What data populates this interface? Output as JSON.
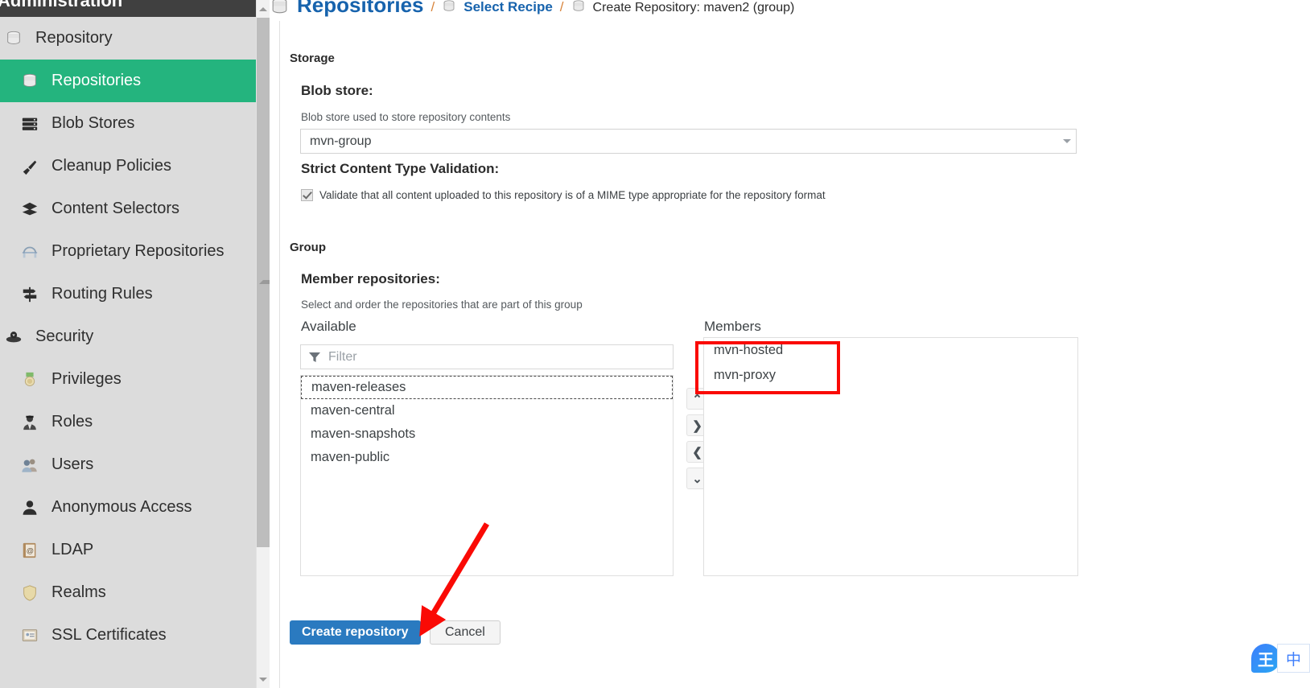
{
  "app": {
    "header_title": "Administration"
  },
  "sidebar": {
    "items": [
      {
        "label": "Repository",
        "icon": "database-icon",
        "level": 0,
        "active": false
      },
      {
        "label": "Repositories",
        "icon": "database-icon",
        "level": 1,
        "active": true
      },
      {
        "label": "Blob Stores",
        "icon": "server-icon",
        "level": 1,
        "active": false
      },
      {
        "label": "Cleanup Policies",
        "icon": "broom-icon",
        "level": 1,
        "active": false
      },
      {
        "label": "Content Selectors",
        "icon": "layers-icon",
        "level": 1,
        "active": false
      },
      {
        "label": "Proprietary Repositories",
        "icon": "bridge-icon",
        "level": 1,
        "active": false
      },
      {
        "label": "Routing Rules",
        "icon": "signpost-icon",
        "level": 1,
        "active": false
      },
      {
        "label": "Security",
        "icon": "shield-user-icon",
        "level": 0,
        "active": false
      },
      {
        "label": "Privileges",
        "icon": "medal-icon",
        "level": 1,
        "active": false
      },
      {
        "label": "Roles",
        "icon": "officer-icon",
        "level": 1,
        "active": false
      },
      {
        "label": "Users",
        "icon": "users-icon",
        "level": 1,
        "active": false
      },
      {
        "label": "Anonymous Access",
        "icon": "person-icon",
        "level": 1,
        "active": false
      },
      {
        "label": "LDAP",
        "icon": "address-book-icon",
        "level": 1,
        "active": false
      },
      {
        "label": "Realms",
        "icon": "shield-icon",
        "level": 1,
        "active": false
      },
      {
        "label": "SSL Certificates",
        "icon": "certificate-icon",
        "level": 1,
        "active": false
      }
    ],
    "active_color": "#24b47e",
    "background": "#dcdcdc"
  },
  "breadcrumb": {
    "separator": "/",
    "items": [
      {
        "label": "Repositories",
        "icon": "database-icon",
        "link": true
      },
      {
        "label": "Select Recipe",
        "icon": "database-icon",
        "link": true
      },
      {
        "label": "Create Repository: maven2 (group)",
        "icon": "database-icon",
        "link": false
      }
    ],
    "link_color": "#1763ad"
  },
  "form": {
    "storage": {
      "section_title": "Storage",
      "blob_store": {
        "label": "Blob store:",
        "help": "Blob store used to store repository contents",
        "value": "mvn-group",
        "options": [
          "mvn-group"
        ]
      },
      "strict_validation": {
        "label": "Strict Content Type Validation:",
        "checkbox_label": "Validate that all content uploaded to this repository is of a MIME type appropriate for the repository format",
        "checked": true
      }
    },
    "group": {
      "section_title": "Group",
      "member_repositories": {
        "label": "Member repositories:",
        "help": "Select and order the repositories that are part of this group",
        "available_heading": "Available",
        "members_heading": "Members",
        "filter_placeholder": "Filter",
        "filter_value": "",
        "available": [
          {
            "name": "maven-releases",
            "focused": true
          },
          {
            "name": "maven-central",
            "focused": false
          },
          {
            "name": "maven-snapshots",
            "focused": false
          },
          {
            "name": "maven-public",
            "focused": false
          }
        ],
        "members": [
          {
            "name": "mvn-hosted"
          },
          {
            "name": "mvn-proxy"
          }
        ],
        "transfer_buttons": [
          {
            "name": "move-up",
            "glyph": "⌃"
          },
          {
            "name": "move-right",
            "glyph": "❯"
          },
          {
            "name": "move-left",
            "glyph": "❮"
          },
          {
            "name": "move-down",
            "glyph": "⌄"
          }
        ]
      }
    },
    "actions": {
      "submit_label": "Create repository",
      "cancel_label": "Cancel",
      "submit_color": "#2a7ac0"
    }
  },
  "annotations": {
    "highlight_color": "#fa0a05",
    "box_target": "members-list-entries",
    "arrow_target": "create-repository-button"
  },
  "ime": {
    "badge_glyph": "王",
    "mode_label": "中"
  }
}
